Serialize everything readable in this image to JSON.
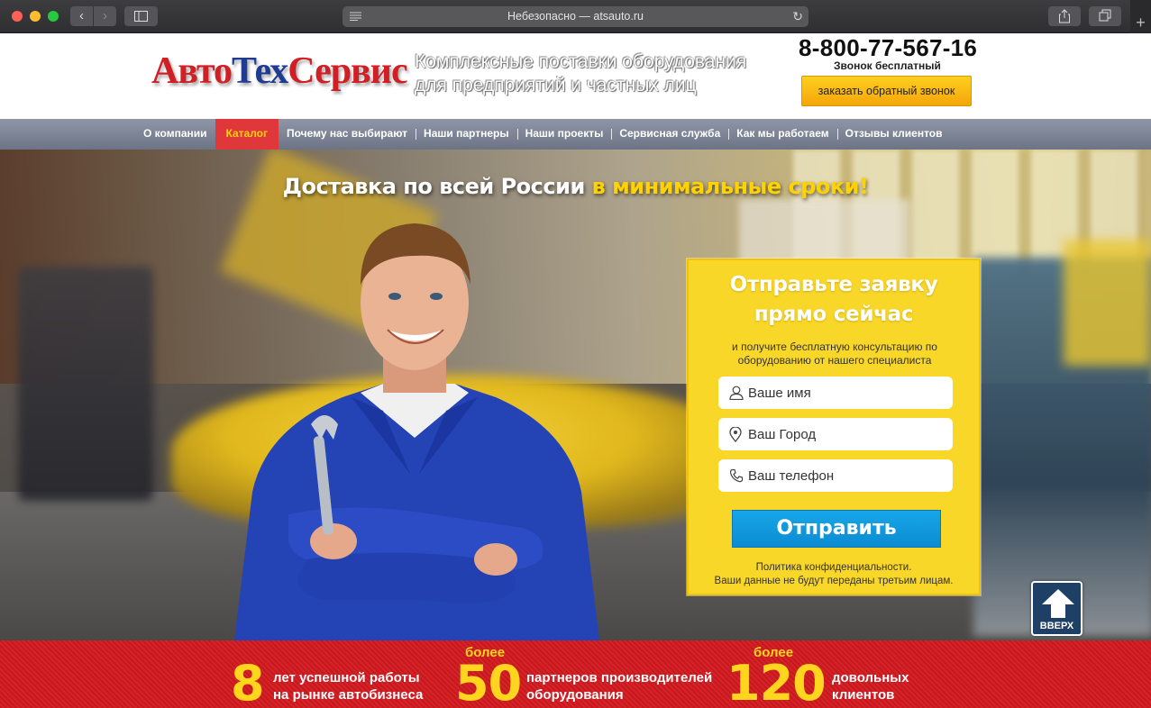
{
  "browser": {
    "url_text": "Небезопасно — atsauto.ru",
    "back_icon": "‹",
    "forward_icon": "›",
    "reload_icon": "↻",
    "newtab_icon": "+"
  },
  "header": {
    "logo": {
      "part1": "Авто",
      "part2": "Тех",
      "part3": "Сервис"
    },
    "tagline_line1": "Комплексные поставки оборудования",
    "tagline_line2": "для предприятий и частных лиц",
    "phone": "8-800-77-567-16",
    "phone_note": "Звонок бесплатный",
    "callback_label": "заказать обратный звонок"
  },
  "nav": {
    "items": [
      {
        "label": "О компании"
      },
      {
        "label": "Каталог",
        "active": true
      },
      {
        "label": "Почему нас выбирают"
      },
      {
        "label": "Наши партнеры"
      },
      {
        "label": "Наши проекты"
      },
      {
        "label": "Сервисная служба"
      },
      {
        "label": "Как мы работаем"
      },
      {
        "label": "Отзывы клиентов"
      }
    ]
  },
  "hero": {
    "title_main": "Доставка по всей России ",
    "title_accent": "в минимальные сроки!"
  },
  "form": {
    "title_line1": "Отправьте заявку",
    "title_line2": "прямо сейчас",
    "subtitle_line1": "и получите бесплатную консультацию по",
    "subtitle_line2": "оборудованию от нашего специалиста",
    "name_placeholder": "Ваше имя",
    "city_placeholder": "Ваш Город",
    "phone_placeholder": "Ваш телефон",
    "submit_label": "Отправить",
    "policy_line1": "Политика конфиденциальности.",
    "policy_line2": "Ваши данные не будут переданы третьим лицам."
  },
  "up_button": {
    "label": "ВВЕРХ"
  },
  "stats": [
    {
      "prefix": "",
      "number": "8",
      "label_line1": "лет успешной работы",
      "label_line2": "на рынке автобизнеса"
    },
    {
      "prefix": "более",
      "number": "50",
      "label_line1": "партнеров производителей",
      "label_line2": "оборудования"
    },
    {
      "prefix": "более",
      "number": "120",
      "label_line1": "довольных",
      "label_line2": "клиентов"
    }
  ],
  "colors": {
    "accent_yellow": "#ffd200",
    "nav_active_bg": "#e0383a",
    "form_bg": "#f9d728",
    "submit_blue": "#0b8bd2",
    "stats_red": "#d3242a"
  }
}
